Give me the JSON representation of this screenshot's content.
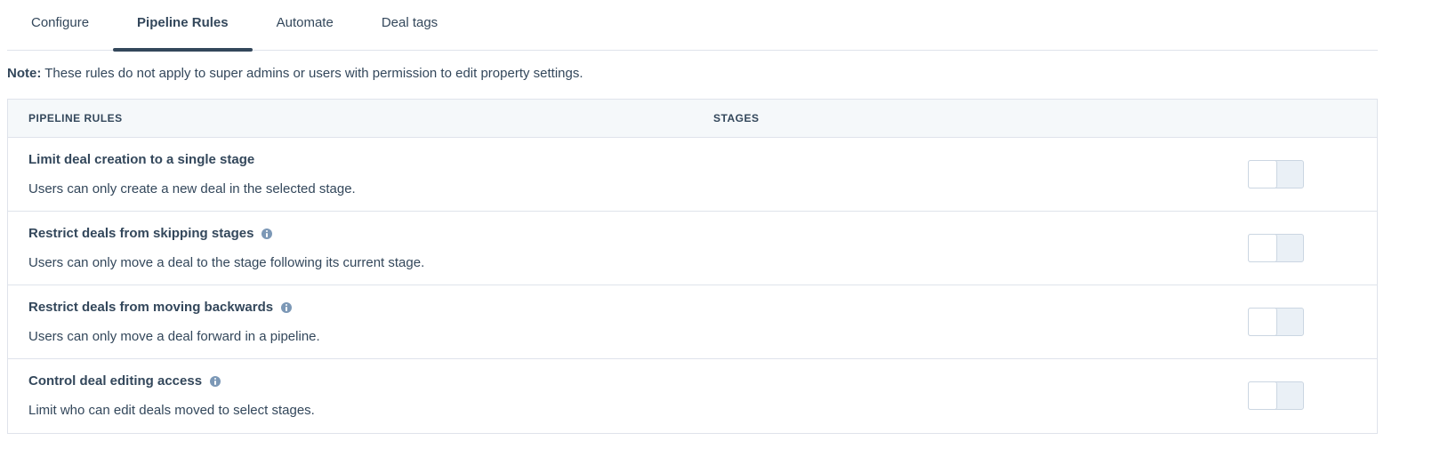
{
  "tabs": [
    {
      "label": "Configure",
      "active": false
    },
    {
      "label": "Pipeline Rules",
      "active": true
    },
    {
      "label": "Automate",
      "active": false
    },
    {
      "label": "Deal tags",
      "active": false
    }
  ],
  "note": {
    "prefix": "Note:",
    "text": " These rules do not apply to super admins or users with permission to edit property settings."
  },
  "table": {
    "headers": {
      "rules": "PIPELINE RULES",
      "stages": "STAGES"
    },
    "rows": [
      {
        "title": "Limit deal creation to a single stage",
        "description": "Users can only create a new deal in the selected stage.",
        "has_info": false,
        "enabled": false
      },
      {
        "title": "Restrict deals from skipping stages",
        "description": "Users can only move a deal to the stage following its current stage.",
        "has_info": true,
        "enabled": false
      },
      {
        "title": "Restrict deals from moving backwards",
        "description": "Users can only move a deal forward in a pipeline.",
        "has_info": true,
        "enabled": false
      },
      {
        "title": "Control deal editing access",
        "description": "Limit who can edit deals moved to select stages.",
        "has_info": true,
        "enabled": false
      }
    ]
  },
  "icons": {
    "info": "info-icon"
  },
  "colors": {
    "text": "#33475b",
    "border": "#dfe3eb",
    "header_bg": "#f5f8fa",
    "info_icon": "#7c98b6",
    "toggle_off_bg": "#eaf0f6"
  }
}
